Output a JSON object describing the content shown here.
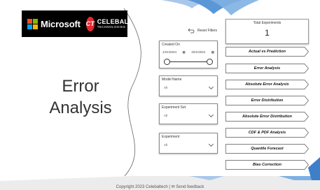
{
  "brand": {
    "microsoft": "Microsoft",
    "ct_mark": "CT",
    "celebal_name": "CELEBAL",
    "celebal_sub": "TECHNOLOGIES"
  },
  "page_title": "Error Analysis",
  "reset_filters": "Reset Filters",
  "total_experiments": {
    "label": "Total Experiments",
    "value": "1"
  },
  "filters": {
    "created_on": {
      "title": "Created On",
      "start": "1/21/2024",
      "end": "3/21/2024"
    },
    "model_name": {
      "title": "Model Name",
      "value": "All"
    },
    "experiment_set": {
      "title": "Experiment Set",
      "value": "All"
    },
    "experiment": {
      "title": "Experiment",
      "value": "All"
    }
  },
  "nav_buttons": [
    "Actual vs Prediction",
    "Error Analysis",
    "Absolute Error Analysis",
    "Error Distribution",
    "Absolute Error Distribution",
    "CDF & PDF Analysis",
    "Quantile Forecast",
    "Bias Correction"
  ],
  "footer": "Copyright 2023 Celebaltech | ✉ Send feedback"
}
